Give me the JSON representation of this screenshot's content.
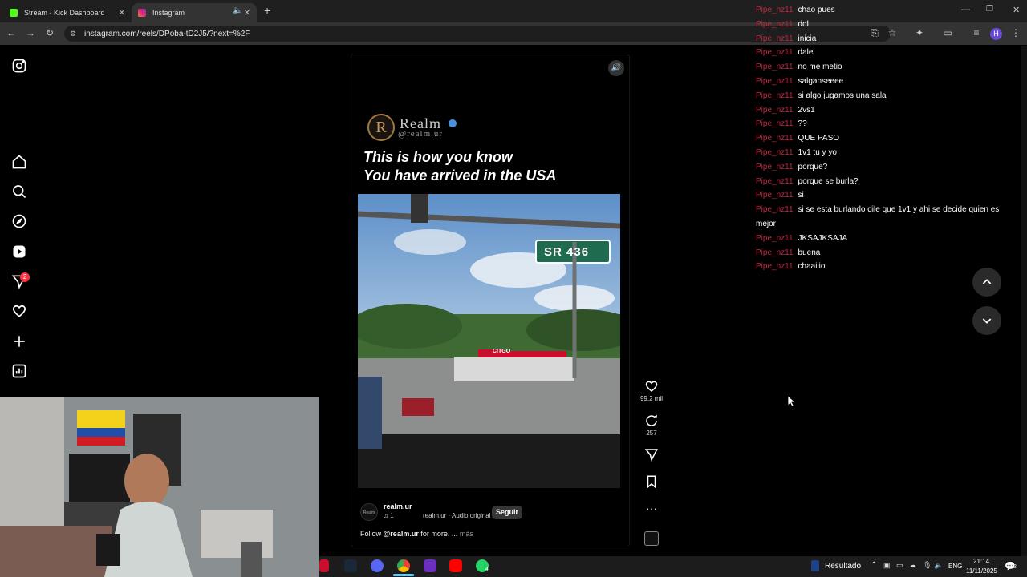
{
  "browser": {
    "tabs": [
      {
        "title": "Stream - Kick Dashboard",
        "favicon_color": "#53fc18"
      },
      {
        "title": "Instagram",
        "favicon_color": "#dd2a7b"
      }
    ],
    "new_tab_label": "+",
    "url": "instagram.com/reels/DPoba-tD2J5/?next=%2F",
    "profile_initial": "H"
  },
  "instagram": {
    "notification_badge": "2",
    "reel": {
      "brand_name": "Realm",
      "brand_handle": "@realm.ur",
      "headline_line1": "This is how you know",
      "headline_line2": "You have arrived in the USA",
      "street_sign": "SR 436",
      "station_sign": "CITGO",
      "author": "realm.ur",
      "music_note": "♫ 1",
      "audio": "realm.ur · Audio original",
      "follow_label": "Seguir",
      "caption_handle": "@realm.ur",
      "caption_prefix": "Follow",
      "caption_suffix": "for more. ...",
      "more_label": "más",
      "likes": "99,2 mil",
      "comments": "257",
      "author_logo_text": "Realm"
    }
  },
  "chat": {
    "username": "Pipe_nz11",
    "messages": [
      "chao pues",
      "ddl",
      "inicia",
      "dale",
      "no me metio",
      "salganseeee",
      "si algo jugamos una sala",
      "2vs1",
      "??",
      "QUE PASO",
      "1v1 tu y yo",
      "porque?",
      "porque se burla?",
      "si",
      "si se esta burlando dile que 1v1 y ahi se decide quien es mejor",
      "JKSAJKSAJA",
      "buena",
      "chaaiiio"
    ]
  },
  "taskbar": {
    "weather_label": "Resultado",
    "language": "ENG",
    "time": "21:14",
    "date": "11/11/2025",
    "notification_count": "2",
    "whatsapp_badge": "4"
  },
  "colors": {
    "chat_username": "#c0283d",
    "instagram_badge": "#ff3040",
    "follow_button_bg": "#363636"
  }
}
